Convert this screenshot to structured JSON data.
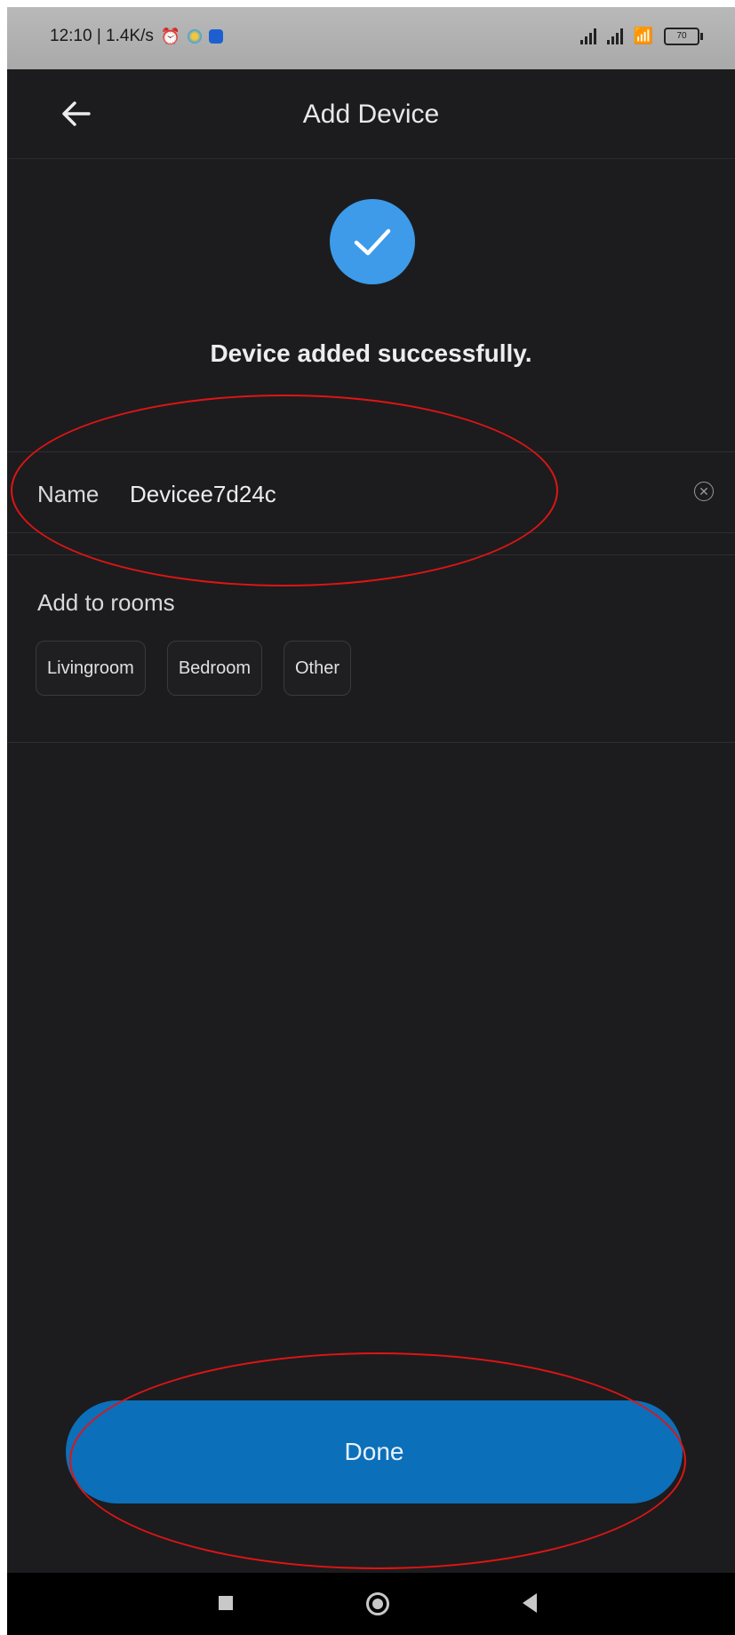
{
  "status_bar": {
    "time_speed": "12:10 | 1.4K/s",
    "battery": "70"
  },
  "header": {
    "title": "Add Device"
  },
  "success": {
    "message": "Device added successfully."
  },
  "name_field": {
    "label": "Name",
    "value": "Devicee7d24c"
  },
  "rooms": {
    "label": "Add to rooms",
    "chips": [
      "Livingroom",
      "Bedroom",
      "Other"
    ]
  },
  "done_label": "Done",
  "colors": {
    "background": "#1c1c1e",
    "accent": "#3d9be9",
    "button": "#0c6fb9",
    "annotation": "#e01414"
  }
}
